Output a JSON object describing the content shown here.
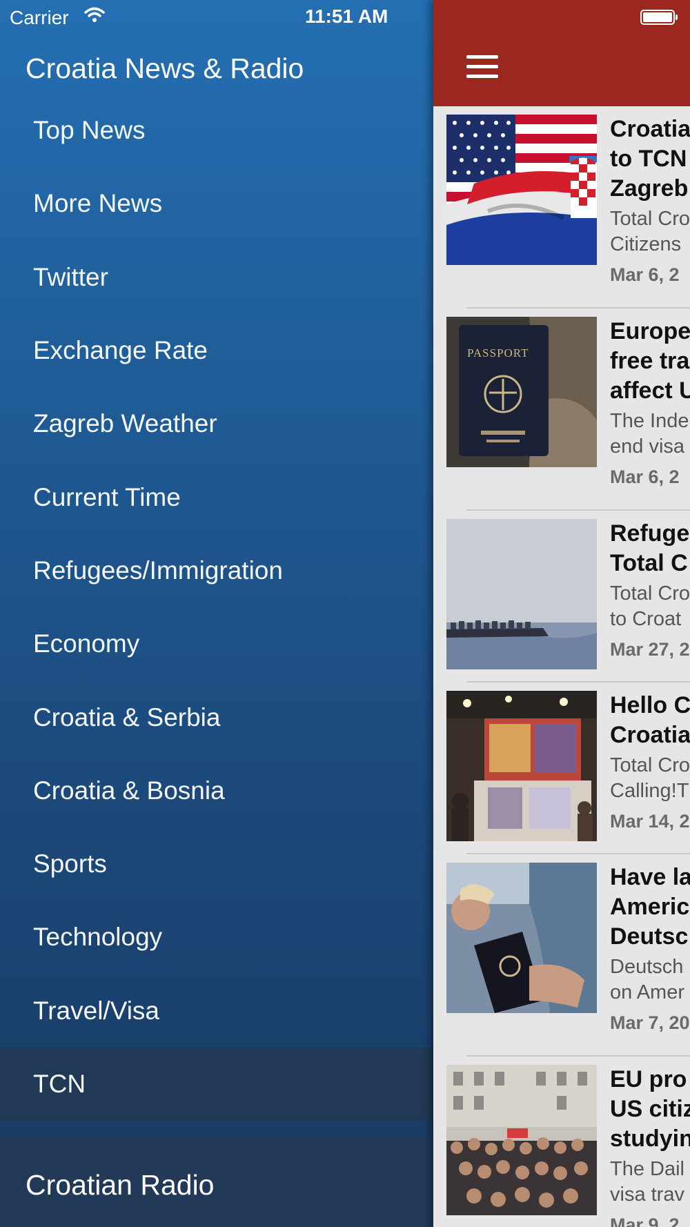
{
  "status_bar": {
    "carrier": "Carrier",
    "time": "11:51 AM"
  },
  "menu": {
    "title": "Croatia News & Radio",
    "items": [
      {
        "label": "Top News"
      },
      {
        "label": "More News"
      },
      {
        "label": "Twitter"
      },
      {
        "label": "Exchange Rate"
      },
      {
        "label": "Zagreb Weather"
      },
      {
        "label": "Current Time"
      },
      {
        "label": "Refugees/Immigration"
      },
      {
        "label": "Economy"
      },
      {
        "label": "Croatia & Serbia"
      },
      {
        "label": "Croatia & Bosnia"
      },
      {
        "label": "Sports"
      },
      {
        "label": "Technology"
      },
      {
        "label": "Travel/Visa"
      },
      {
        "label": "TCN"
      }
    ],
    "selected": "TCN",
    "radio_heading": "Croatian Radio"
  },
  "colors": {
    "navbar": "#9b2720",
    "menu_top": "#246fb2",
    "menu_bottom": "#1a3a62"
  },
  "articles": [
    {
      "headline": "Croatia\nto TCN\nZagreb",
      "summary": "Total Cro\nCitizens",
      "date": "Mar 6, 2",
      "image": "flags-usa-croatia"
    },
    {
      "headline": "Europe\nfree tra\naffect U",
      "summary": "The Inde\nend visa",
      "date": "Mar 6, 2",
      "image": "passport"
    },
    {
      "headline": "Refuge\nTotal C",
      "summary": "Total Cro\nto Croat",
      "date": "Mar 27, 2",
      "image": "boat-at-sea"
    },
    {
      "headline": "Hello C\nCroatia",
      "summary": "Total Cro\nCalling!T",
      "date": "Mar 14, 2",
      "image": "travel-fair-booth"
    },
    {
      "headline": "Have la\nAmeric\nDeutsc",
      "summary": "Deutsch\non Amer",
      "date": "Mar 7, 20",
      "image": "passport-in-hand"
    },
    {
      "headline": "EU pro\nUS citiz\nstudyin",
      "summary": "The Dail\nvisa trav",
      "date": "Mar 9, 2",
      "image": "crowd-in-street"
    }
  ]
}
